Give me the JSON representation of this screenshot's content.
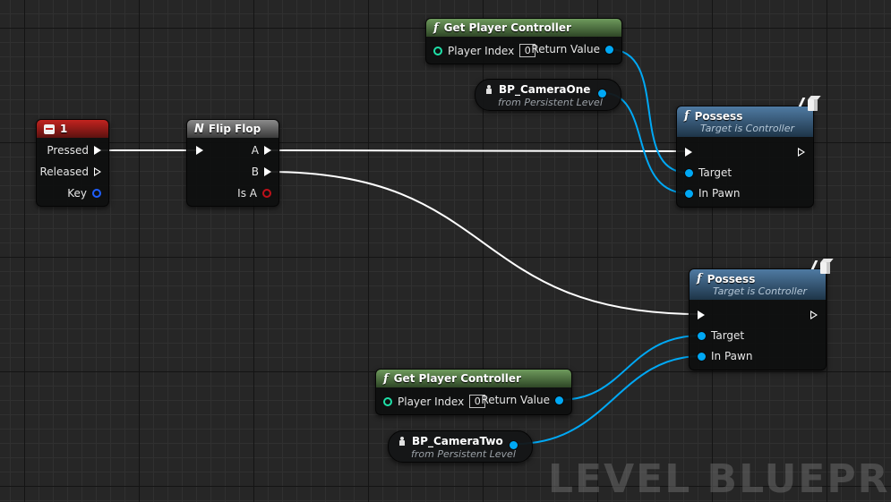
{
  "nodes": {
    "key_event": {
      "title": "1",
      "pins": {
        "pressed": "Pressed",
        "released": "Released",
        "key": "Key"
      }
    },
    "flip_flop": {
      "title": "Flip Flop",
      "pins": {
        "a": "A",
        "b": "B",
        "is_a": "Is A"
      }
    },
    "get_pc_top": {
      "title": "Get Player Controller",
      "player_index_label": "Player Index",
      "player_index_value": "0",
      "return_value": "Return Value"
    },
    "cam_one": {
      "title": "BP_CameraOne",
      "subtitle": "from Persistent Level"
    },
    "possess_top": {
      "title": "Possess",
      "subtitle": "Target is Controller",
      "pins": {
        "target": "Target",
        "in_pawn": "In Pawn"
      }
    },
    "possess_bottom": {
      "title": "Possess",
      "subtitle": "Target is Controller",
      "pins": {
        "target": "Target",
        "in_pawn": "In Pawn"
      }
    },
    "get_pc_bottom": {
      "title": "Get Player Controller",
      "player_index_label": "Player Index",
      "player_index_value": "0",
      "return_value": "Return Value"
    },
    "cam_two": {
      "title": "BP_CameraTwo",
      "subtitle": "from Persistent Level"
    }
  },
  "watermark": "LEVEL BLUEPRI",
  "colors": {
    "object_pin": "#00a8f4",
    "bool_pin": "#c0101a",
    "key_pin": "#1f5fff",
    "int_pin": "#1fe0a8",
    "exec_wire": "#ffffff"
  }
}
